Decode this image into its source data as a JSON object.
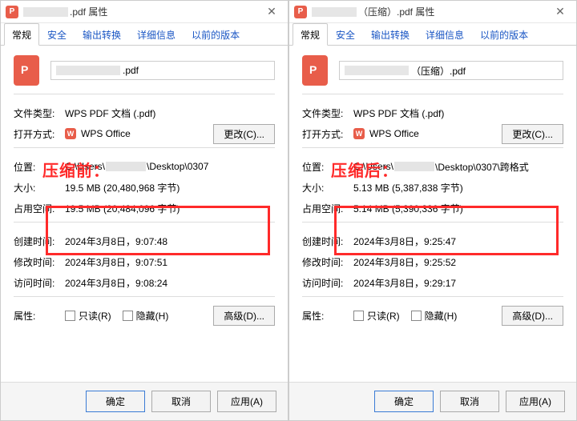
{
  "overlay": {
    "before": "压缩前：",
    "after": "压缩后："
  },
  "left": {
    "title_suffix": ".pdf 属性",
    "tabs": [
      "常规",
      "安全",
      "输出转换",
      "详细信息",
      "以前的版本"
    ],
    "filename_suffix": ".pdf",
    "labels": {
      "type": "文件类型:",
      "openwith": "打开方式:",
      "location": "位置:",
      "size": "大小:",
      "sizeondisk": "占用空间:",
      "created": "创建时间:",
      "modified": "修改时间:",
      "accessed": "访问时间:",
      "attributes": "属性:"
    },
    "values": {
      "type": "WPS PDF 文档 (.pdf)",
      "openwith": "WPS Office",
      "location_prefix": "C:\\Users\\",
      "location_suffix": "\\Desktop\\0307",
      "size": "19.5 MB (20,480,968 字节)",
      "sizeondisk": "19.5 MB (20,484,096 字节)",
      "created": "2024年3月8日，9:07:48",
      "modified": "2024年3月8日，9:07:51",
      "accessed": "2024年3月8日，9:08:24"
    },
    "buttons": {
      "change": "更改(C)...",
      "advanced": "高级(D)...",
      "readonly": "只读(R)",
      "hidden": "隐藏(H)",
      "ok": "确定",
      "cancel": "取消",
      "apply": "应用(A)"
    }
  },
  "right": {
    "title_suffix": "（压缩）.pdf 属性",
    "tabs": [
      "常规",
      "安全",
      "输出转换",
      "详细信息",
      "以前的版本"
    ],
    "filename_suffix": "（压缩）.pdf",
    "labels": {
      "type": "文件类型:",
      "openwith": "打开方式:",
      "location": "位置:",
      "size": "大小:",
      "sizeondisk": "占用空间:",
      "created": "创建时间:",
      "modified": "修改时间:",
      "accessed": "访问时间:",
      "attributes": "属性:"
    },
    "values": {
      "type": "WPS PDF 文档 (.pdf)",
      "openwith": "WPS Office",
      "location_prefix": "C:\\Users\\",
      "location_suffix": "\\Desktop\\0307\\跨格式",
      "size": "5.13 MB (5,387,838 字节)",
      "sizeondisk": "5.14 MB (5,390,336 字节)",
      "created": "2024年3月8日，9:25:47",
      "modified": "2024年3月8日，9:25:52",
      "accessed": "2024年3月8日，9:29:17"
    },
    "buttons": {
      "change": "更改(C)...",
      "advanced": "高级(D)...",
      "readonly": "只读(R)",
      "hidden": "隐藏(H)",
      "ok": "确定",
      "cancel": "取消",
      "apply": "应用(A)"
    }
  }
}
